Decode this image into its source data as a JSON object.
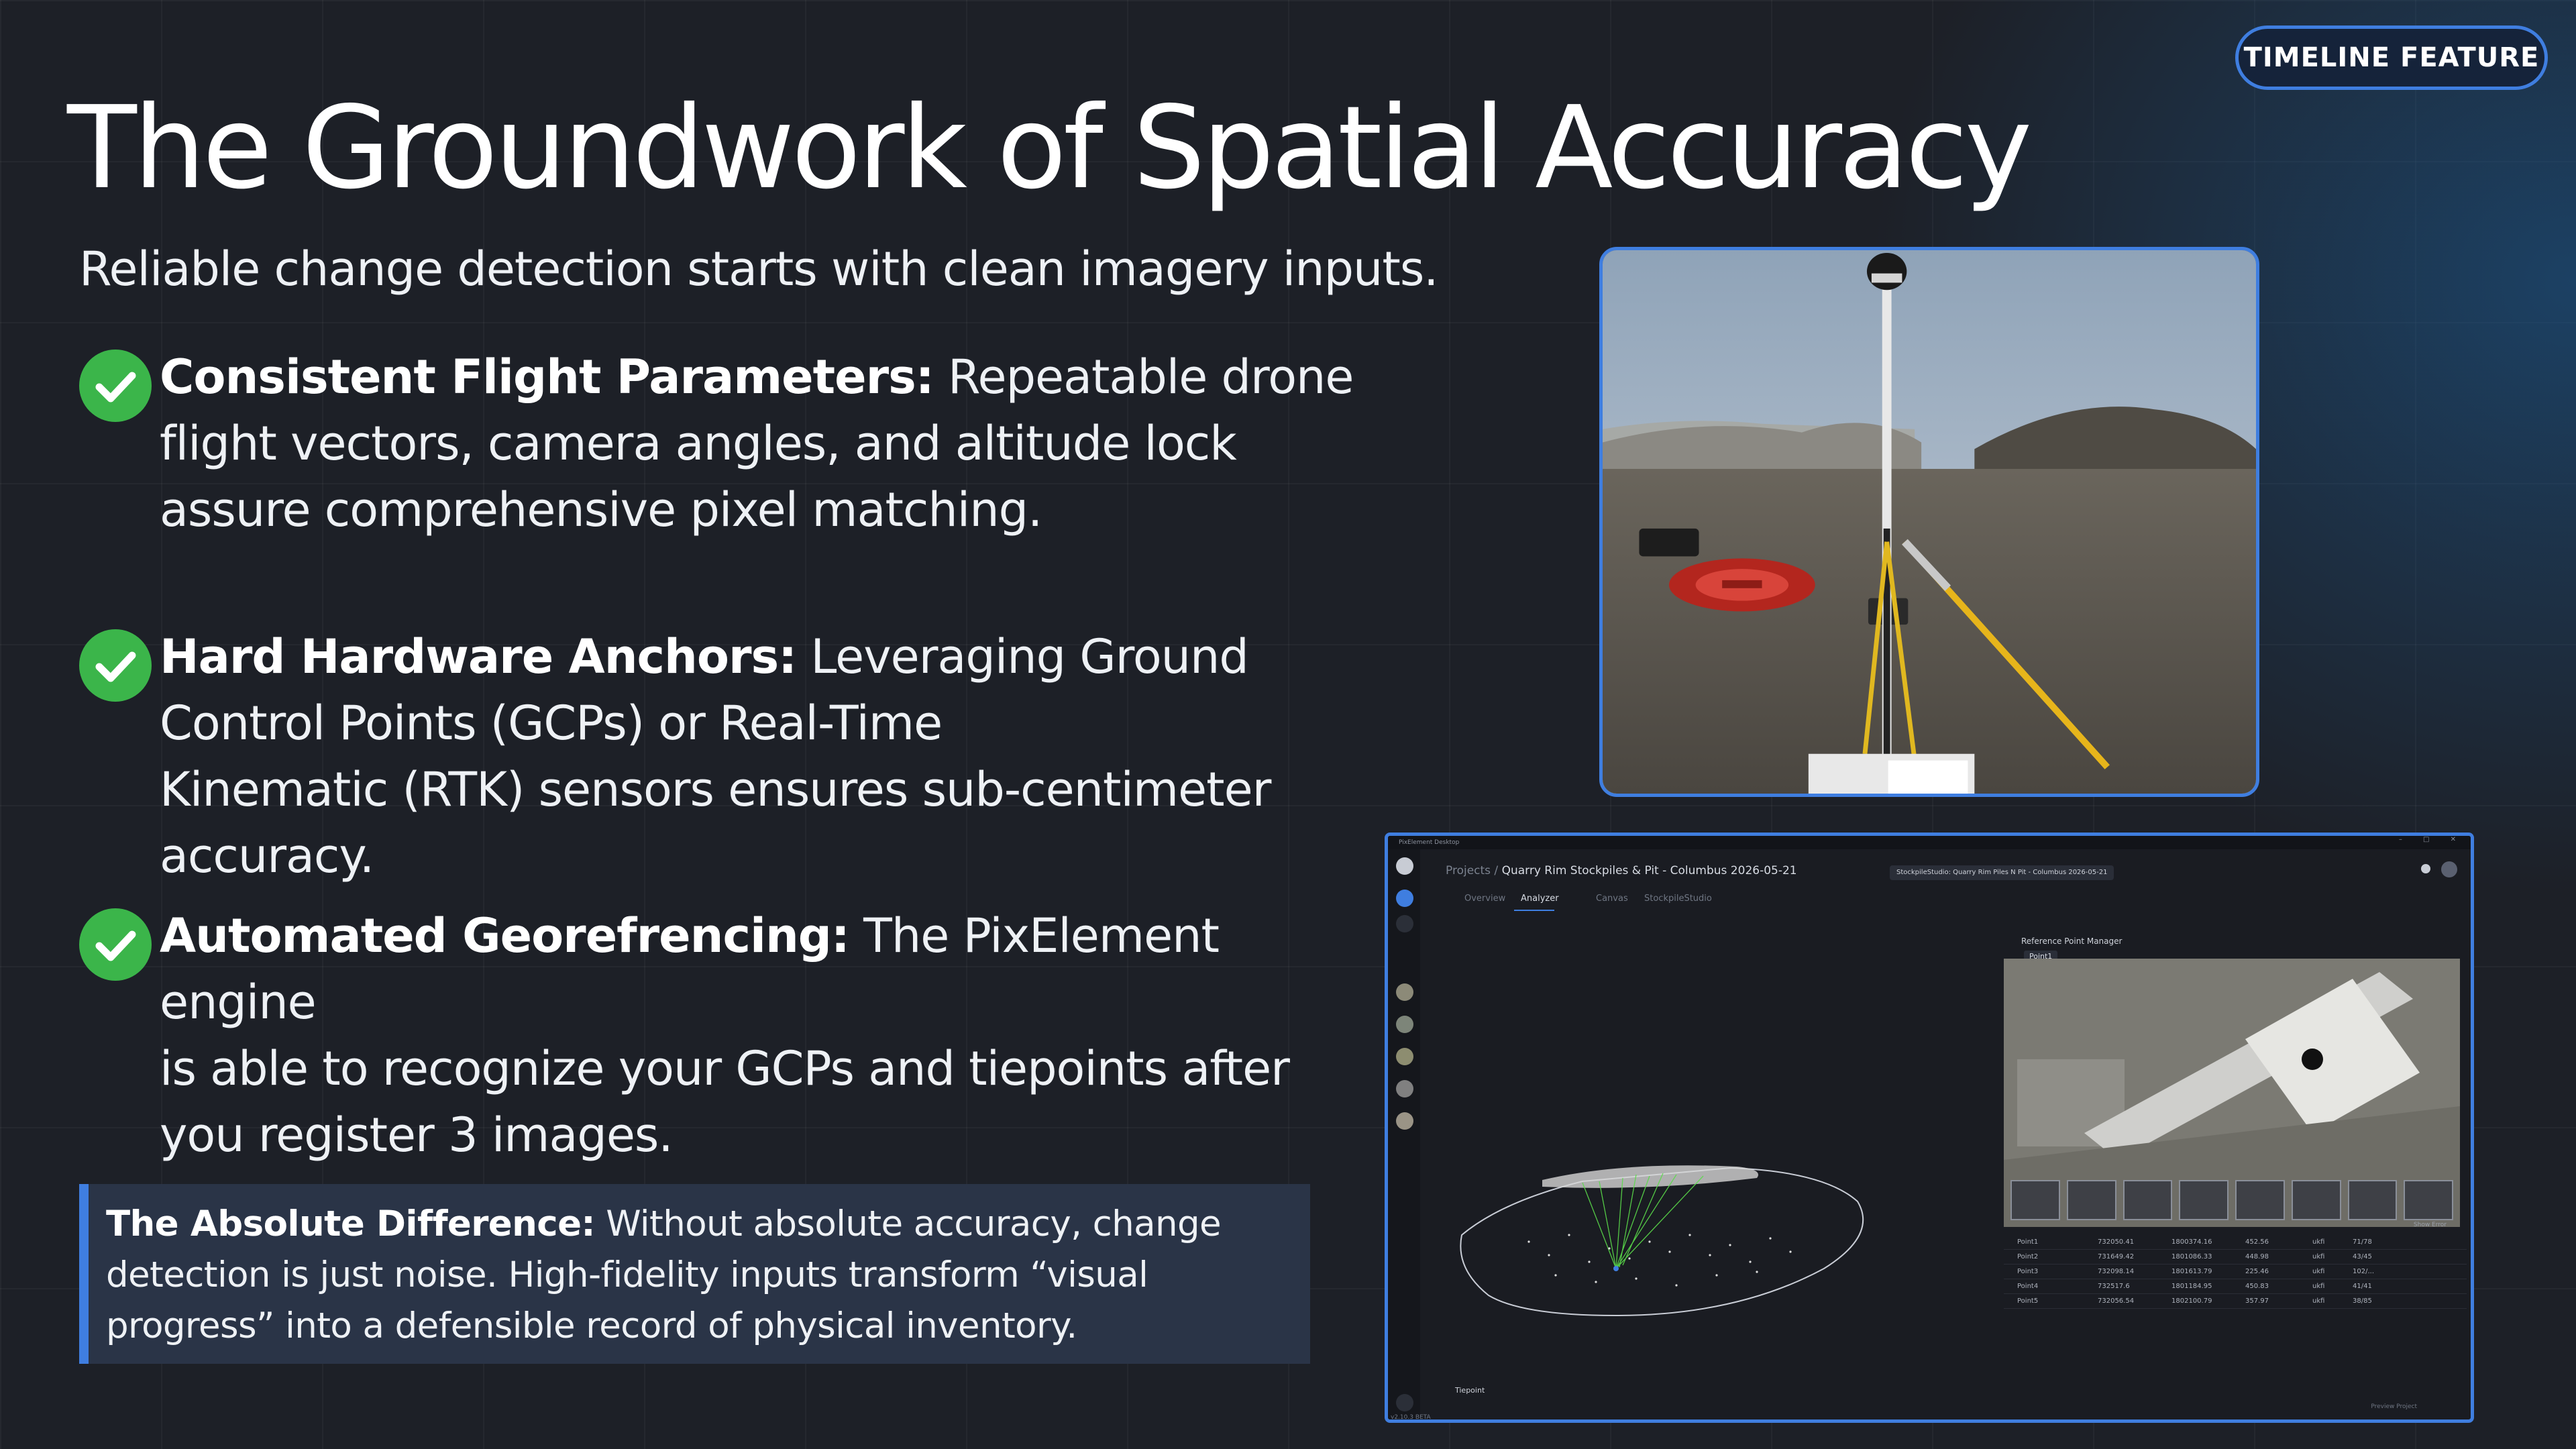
{
  "badge": "TIMELINE FEATURE",
  "title": "The Groundwork of Spatial Accuracy",
  "subtitle": "Reliable change detection starts with clean imagery inputs.",
  "bullets": [
    {
      "bold": "Consistent Flight Parameters:",
      "lines": [
        " Repeatable drone",
        "flight vectors, camera angles, and altitude lock",
        "assure comprehensive pixel matching."
      ]
    },
    {
      "bold": "Hard Hardware Anchors:",
      "lines": [
        " Leveraging Ground",
        "Control Points (GCPs) or Real-Time",
        "Kinematic (RTK) sensors ensures sub-centimeter",
        "accuracy."
      ]
    },
    {
      "bold": "Automated Georefrencing:",
      "lines": [
        " The PixElement engine",
        "is able to recognize your GCPs and tiepoints after",
        "you register 3 images."
      ]
    }
  ],
  "callout": {
    "bold": "The Absolute Difference:",
    "text": " Without absolute accuracy, change detection is just noise. High-fidelity inputs transform “visual progress” into a defensible record of physical inventory."
  },
  "app": {
    "window_title": "PixElement Desktop",
    "breadcrumb_prefix": "Projects /",
    "breadcrumb_project": "Quarry Rim Stockpiles & Pit - Columbus 2026-05-21",
    "chip": "StockpileStudio: Quarry Rim Piles N Pit - Columbus 2026-05-21",
    "tabs": [
      "Overview",
      "Analyzer",
      "Canvas",
      "StockpileStudio"
    ],
    "panel_title": "Reference Point Manager",
    "point_selector": "Point1",
    "show_error": "Show Error",
    "points": [
      {
        "name": "Point1",
        "e": "732050.41",
        "n": "1800374.16",
        "z": "452.56",
        "unit": "ukfi",
        "ratio": "71/78"
      },
      {
        "name": "Point2",
        "e": "731649.42",
        "n": "1801086.33",
        "z": "448.98",
        "unit": "ukfi",
        "ratio": "43/45"
      },
      {
        "name": "Point3",
        "e": "732098.14",
        "n": "1801613.79",
        "z": "225.46",
        "unit": "ukfi",
        "ratio": "102/..."
      },
      {
        "name": "Point4",
        "e": "732517.6",
        "n": "1801184.95",
        "z": "450.83",
        "unit": "ukfi",
        "ratio": "41/41"
      },
      {
        "name": "Point5",
        "e": "732056.54",
        "n": "1802100.79",
        "z": "357.97",
        "unit": "ukfi",
        "ratio": "38/85"
      }
    ],
    "tiepoint_label": "Tiepoint",
    "version": "v2.10.3 BETA",
    "preview_label": "Preview Project"
  },
  "colors": {
    "accent": "#3f7ee0",
    "check": "#3bb54a",
    "callout_bg": "#2a3447"
  }
}
